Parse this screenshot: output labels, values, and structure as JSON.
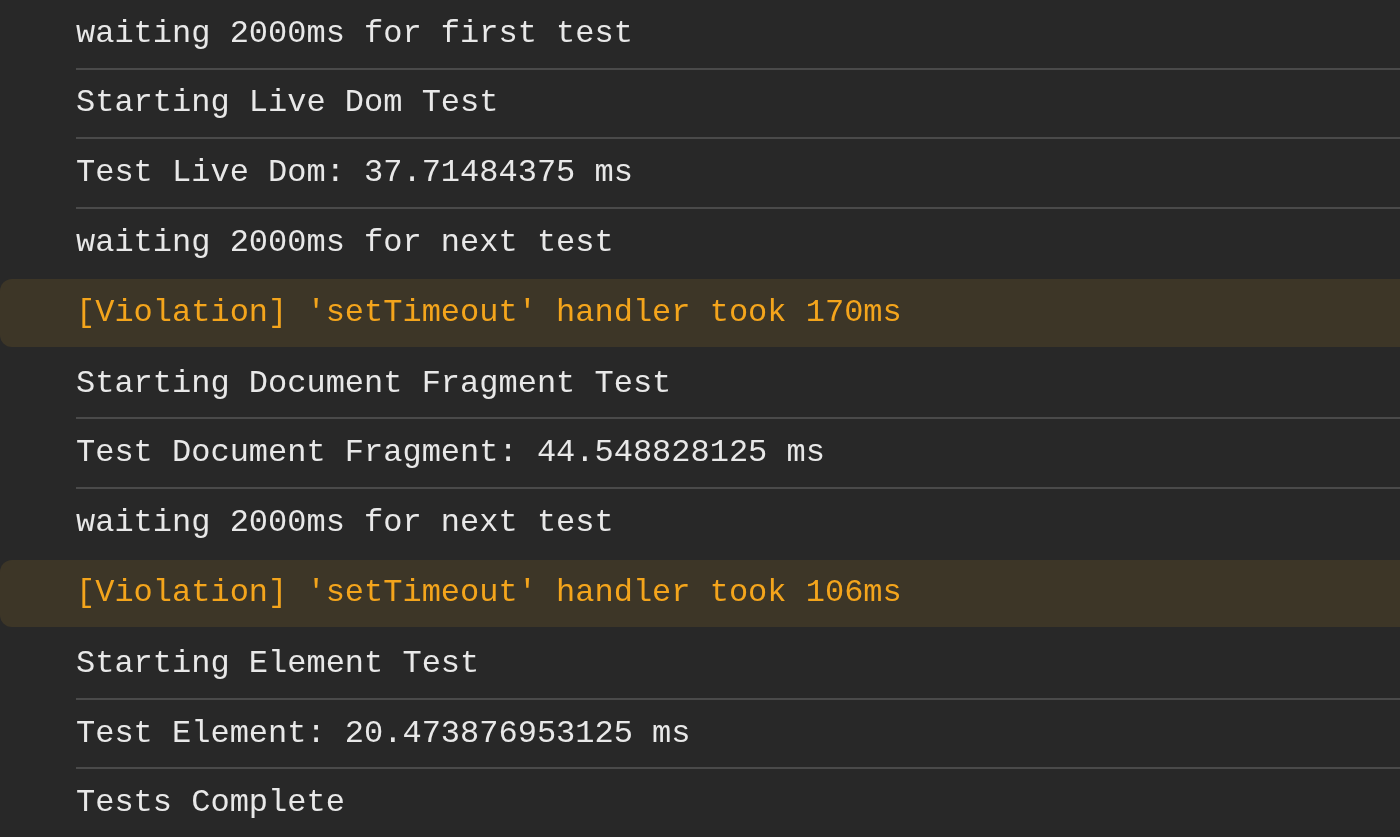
{
  "console": {
    "messages": [
      {
        "kind": "log",
        "text": "waiting 2000ms for first test"
      },
      {
        "kind": "log",
        "text": "Starting Live Dom Test"
      },
      {
        "kind": "log",
        "text": "Test Live Dom: 37.71484375 ms"
      },
      {
        "kind": "log",
        "text": "waiting 2000ms for next test"
      },
      {
        "kind": "warning",
        "text": "[Violation] 'setTimeout' handler took 170ms"
      },
      {
        "kind": "log",
        "text": "Starting Document Fragment Test"
      },
      {
        "kind": "log",
        "text": "Test Document Fragment: 44.548828125 ms"
      },
      {
        "kind": "log",
        "text": "waiting 2000ms for next test"
      },
      {
        "kind": "warning",
        "text": "[Violation] 'setTimeout' handler took 106ms"
      },
      {
        "kind": "log",
        "text": "Starting Element Test"
      },
      {
        "kind": "log",
        "text": "Test Element: 20.473876953125 ms"
      },
      {
        "kind": "log",
        "text": "Tests Complete"
      }
    ]
  }
}
